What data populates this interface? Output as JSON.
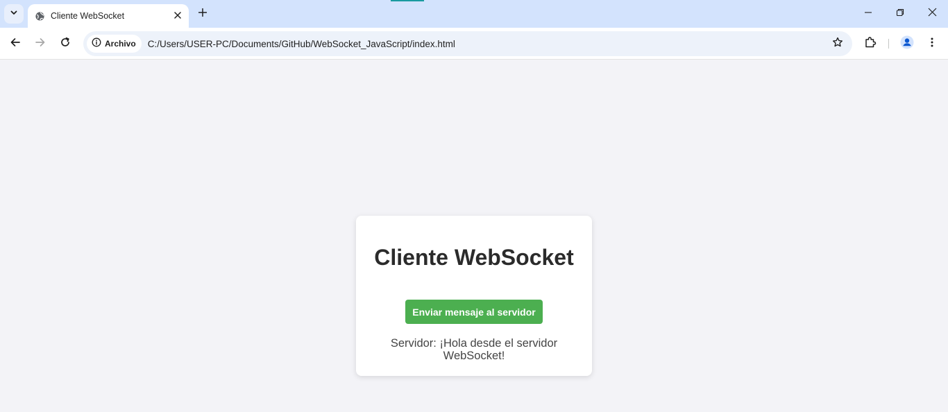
{
  "browser": {
    "tab": {
      "title": "Cliente WebSocket"
    },
    "address_bar": {
      "chip_label": "Archivo",
      "url": "C:/Users/USER-PC/Documents/GitHub/WebSocket_JavaScript/index.html"
    }
  },
  "page": {
    "heading": "Cliente WebSocket",
    "send_button_label": "Enviar mensaje al servidor",
    "server_message": "Servidor: ¡Hola desde el servidor WebSocket!"
  },
  "colors": {
    "tabstrip_bg": "#d3e3fd",
    "page_bg": "#f3f3f7",
    "button_green": "#4caf50",
    "profile_blue": "#1a73e8"
  },
  "icons": [
    "tab-search-icon",
    "globe-icon",
    "close-icon",
    "plus-icon",
    "minimize-icon",
    "restore-icon",
    "window-close-icon",
    "back-arrow-icon",
    "forward-arrow-icon",
    "reload-icon",
    "info-icon",
    "star-icon",
    "extensions-icon",
    "profile-icon",
    "menu-icon"
  ]
}
